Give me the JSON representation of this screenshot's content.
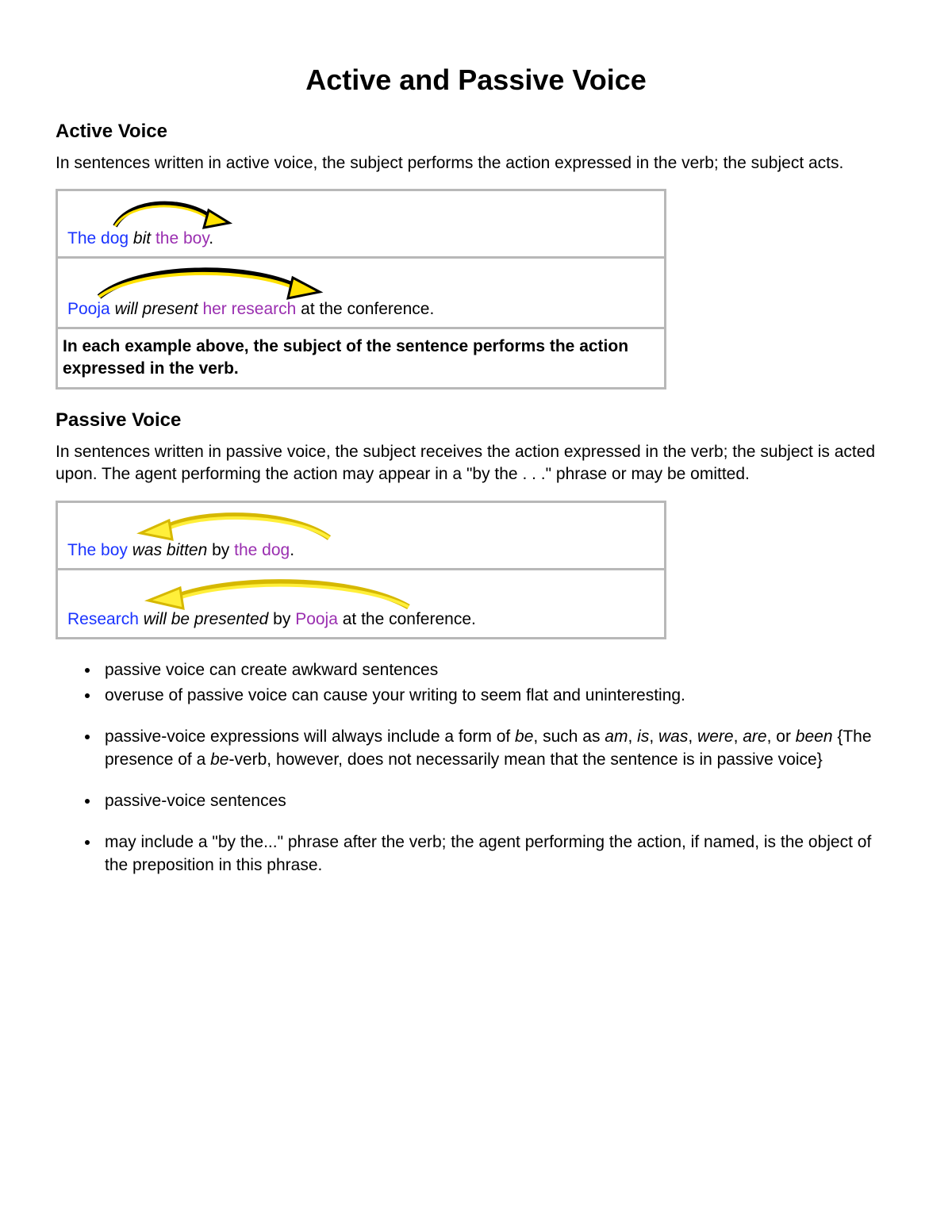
{
  "title": "Active and Passive Voice",
  "active": {
    "heading": "Active Voice",
    "intro": "In sentences written in active voice, the subject performs the action expressed in the verb; the subject acts.",
    "ex1": {
      "subj": "The dog",
      "verb": "bit",
      "obj": "the boy",
      "tail": "."
    },
    "ex2": {
      "subj": "Pooja",
      "verb": "will present",
      "obj": "her research",
      "tail": " at the conference."
    },
    "caption": "In each example above, the subject of the sentence performs the action expressed in the verb."
  },
  "passive": {
    "heading": "Passive Voice",
    "intro": "In sentences written in passive voice, the subject receives the action expressed in the verb; the subject is acted upon. The agent performing the action may appear in a \"by the . . .\" phrase or may be omitted.",
    "ex1": {
      "subj": "The boy",
      "verb": "was bitten",
      "by": " by ",
      "obj": "the dog",
      "tail": "."
    },
    "ex2": {
      "subj": "Research",
      "verb": "will be presented",
      "by": " by ",
      "obj": "Pooja",
      "tail": " at the conference."
    }
  },
  "notes": {
    "n1": "passive voice can create awkward sentences",
    "n2": "overuse of passive voice can cause your writing to seem flat and uninteresting.",
    "n3_a": "passive-voice expressions will always include a form of ",
    "n3_be": "be",
    "n3_b": ", such as ",
    "n3_am": "am",
    "n3_c1": ", ",
    "n3_is": "is",
    "n3_c2": ", ",
    "n3_was": "was",
    "n3_c3": ", ",
    "n3_were": "were",
    "n3_c4": ", ",
    "n3_are": "are",
    "n3_c5": ", or ",
    "n3_been": "been",
    "n3_d": " {The presence of a ",
    "n3_be2": "be",
    "n3_e": "-verb, however, does not necessarily mean that the sentence is in passive voice}",
    "n4": "passive-voice sentences",
    "n5": "may include a \"by the...\" phrase after the verb; the agent performing the action, if named, is the object of the preposition in this phrase."
  }
}
